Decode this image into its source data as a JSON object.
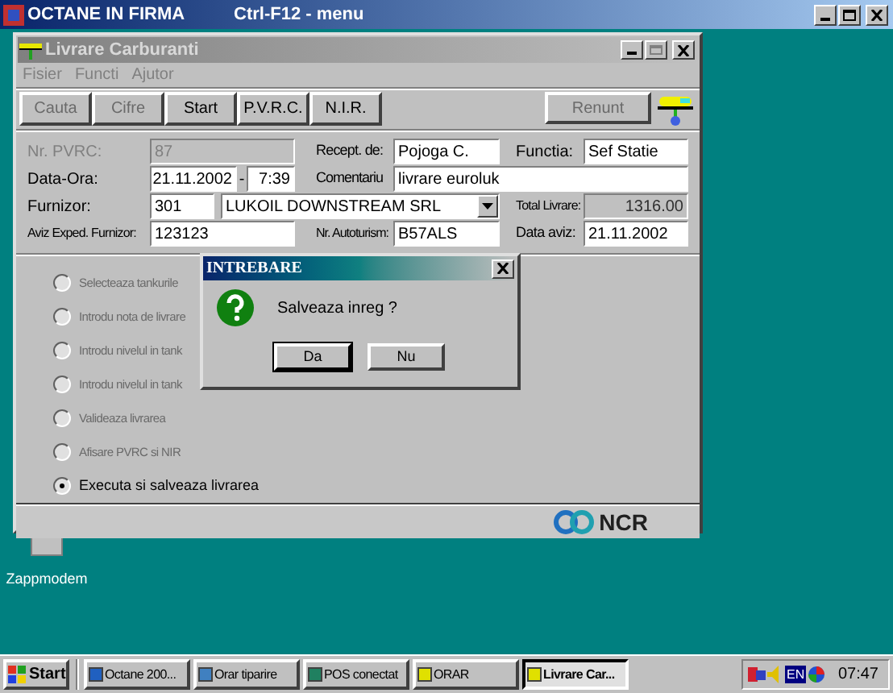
{
  "app_window": {
    "title": "OCTANE IN FIRMA",
    "hint": "Ctrl-F12 - menu"
  },
  "window": {
    "title": "Livrare Carburanti",
    "menu": [
      {
        "label": "Fisier",
        "disabled": true
      },
      {
        "label": "Functi",
        "disabled": true
      },
      {
        "label": "Ajutor",
        "disabled": true
      }
    ],
    "toolbar": [
      {
        "label": "Cauta",
        "disabled": true
      },
      {
        "label": "Cifre",
        "disabled": true
      },
      {
        "label": "Start",
        "disabled": false
      },
      {
        "label": "P.V.R.C.",
        "disabled": false
      },
      {
        "label": "N.I.R.",
        "disabled": false
      }
    ],
    "cancel_button": {
      "label": "Renunt",
      "disabled": true
    },
    "form": {
      "nr_pvrc": {
        "label": "Nr. PVRC:",
        "value": "87",
        "disabled": true
      },
      "recept_de": {
        "label": "Recept. de:",
        "value": "Pojoga C.",
        "disabled": false
      },
      "functia": {
        "label": "Functia:",
        "value": "Sef Statie",
        "disabled": false
      },
      "data_ora": {
        "label": "Data-Ora:",
        "date": "21.11.2002",
        "separator": "-",
        "time": "7:39"
      },
      "comentariu": {
        "label": "Comentariu",
        "value": "livrare euroluk",
        "disabled": false
      },
      "furnizor": {
        "label": "Furnizor:",
        "code": "301",
        "name": "LUKOIL DOWNSTREAM SRL"
      },
      "total_livrare": {
        "label": "Total Livrare:",
        "value": "1316.00",
        "disabled": true
      },
      "aviz_exped": {
        "label": "Aviz Exped. Furnizor:",
        "value": "123123",
        "disabled": false
      },
      "nr_autoturism": {
        "label": "Nr. Autoturism:",
        "value": "B57ALS",
        "disabled": false
      },
      "data_aviz": {
        "label": "Data aviz:",
        "value": "21.11.2002",
        "disabled": false
      }
    },
    "steps": [
      {
        "label": "Selecteaza tankurile",
        "selected": false,
        "disabled": true
      },
      {
        "label": "Introdu nota de livrare",
        "selected": false,
        "disabled": true
      },
      {
        "label": "Introdu nivelul in tank",
        "selected": false,
        "disabled": true
      },
      {
        "label": "Introdu nivelul in tank",
        "selected": false,
        "disabled": true
      },
      {
        "label": "Valideaza livrarea",
        "selected": false,
        "disabled": true
      },
      {
        "label": "Afisare PVRC si NIR",
        "selected": false,
        "disabled": true
      },
      {
        "label": "Executa si salveaza livrarea",
        "selected": true,
        "disabled": false
      }
    ],
    "footer": {
      "logo": "NCR"
    }
  },
  "dialog": {
    "title": "INTREBARE",
    "message": "Salveaza inreg ?",
    "buttons": [
      {
        "label": "Da",
        "default": true
      },
      {
        "label": "Nu",
        "default": false
      }
    ]
  },
  "desktop_icons": [
    {
      "label": "Zappmodem"
    }
  ],
  "taskbar": {
    "start": "Start",
    "tasks": [
      {
        "label": "Octane 200...",
        "selected": false
      },
      {
        "label": "Orar tiparire",
        "selected": false
      },
      {
        "label": "POS conectat",
        "selected": false
      },
      {
        "label": "ORAR",
        "selected": false
      },
      {
        "label": "Livrare Car...",
        "selected": true
      }
    ],
    "language": "EN",
    "clock": "07:47"
  }
}
